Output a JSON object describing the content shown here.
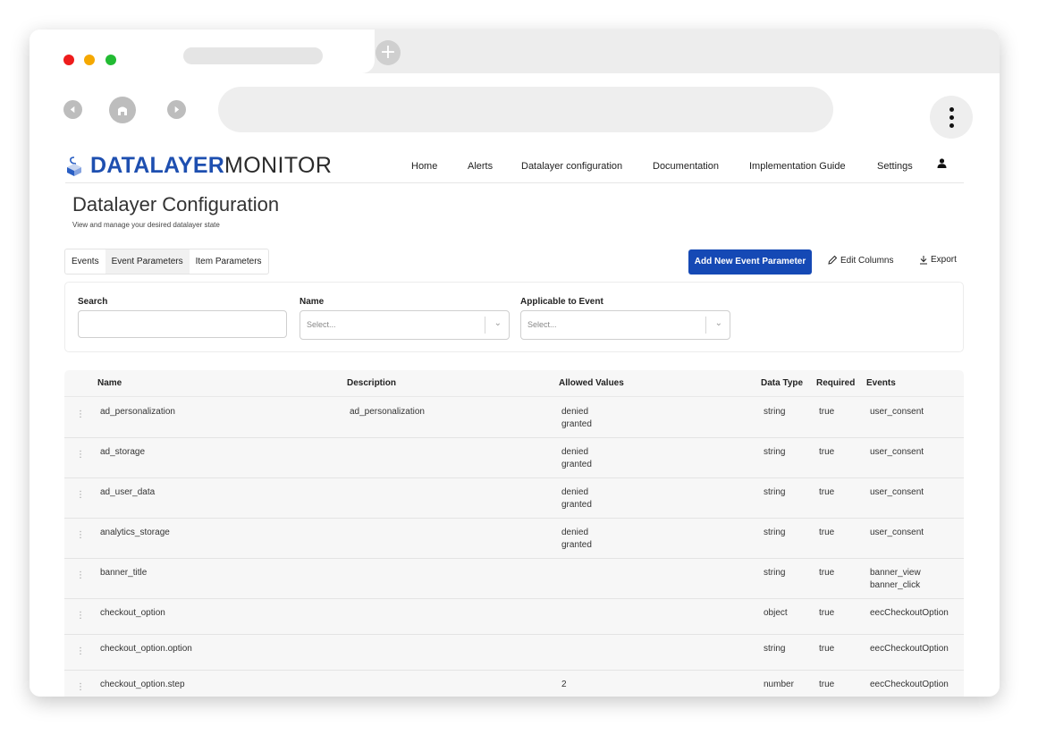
{
  "app": {
    "brand_bold": "DATALAYER",
    "brand_light": "MONITOR",
    "nav": [
      "Home",
      "Alerts",
      "Datalayer configuration",
      "Documentation",
      "Implementation Guide",
      "Settings"
    ]
  },
  "page": {
    "title": "Datalayer Configuration",
    "subtitle": "View and manage your desired datalayer state"
  },
  "tabs": [
    {
      "label": "Events",
      "active": false
    },
    {
      "label": "Event Parameters",
      "active": true
    },
    {
      "label": "Item Parameters",
      "active": false
    }
  ],
  "actions": {
    "add": "Add New Event Parameter",
    "edit": "Edit Columns",
    "export": "Export"
  },
  "filters": {
    "search_label": "Search",
    "name_label": "Name",
    "name_placeholder": "Select...",
    "event_label": "Applicable to Event",
    "event_placeholder": "Select..."
  },
  "table": {
    "columns": [
      "Name",
      "Description",
      "Allowed Values",
      "Data Type",
      "Required",
      "Events"
    ],
    "rows": [
      {
        "name": "ad_personalization",
        "description": "ad_personalization",
        "allowed": "denied\ngranted",
        "type": "string",
        "required": "true",
        "events": "user_consent"
      },
      {
        "name": "ad_storage",
        "description": "",
        "allowed": "denied\ngranted",
        "type": "string",
        "required": "true",
        "events": "user_consent"
      },
      {
        "name": "ad_user_data",
        "description": "",
        "allowed": "denied\ngranted",
        "type": "string",
        "required": "true",
        "events": "user_consent"
      },
      {
        "name": "analytics_storage",
        "description": "",
        "allowed": "denied\ngranted",
        "type": "string",
        "required": "true",
        "events": "user_consent"
      },
      {
        "name": "banner_title",
        "description": "",
        "allowed": "",
        "type": "string",
        "required": "true",
        "events": "banner_view\nbanner_click"
      },
      {
        "name": "checkout_option",
        "description": "",
        "allowed": "",
        "type": "object",
        "required": "true",
        "events": "eecCheckoutOption"
      },
      {
        "name": "checkout_option.option",
        "description": "",
        "allowed": "",
        "type": "string",
        "required": "true",
        "events": "eecCheckoutOption"
      },
      {
        "name": "checkout_option.step",
        "description": "",
        "allowed": "2",
        "type": "number",
        "required": "true",
        "events": "eecCheckoutOption"
      }
    ]
  },
  "colors": {
    "brand_blue": "#1e4fb0",
    "button_blue": "#1549b5",
    "traffic_red": "#ee1c1c",
    "traffic_yellow": "#f5a800",
    "traffic_green": "#22bb33"
  }
}
